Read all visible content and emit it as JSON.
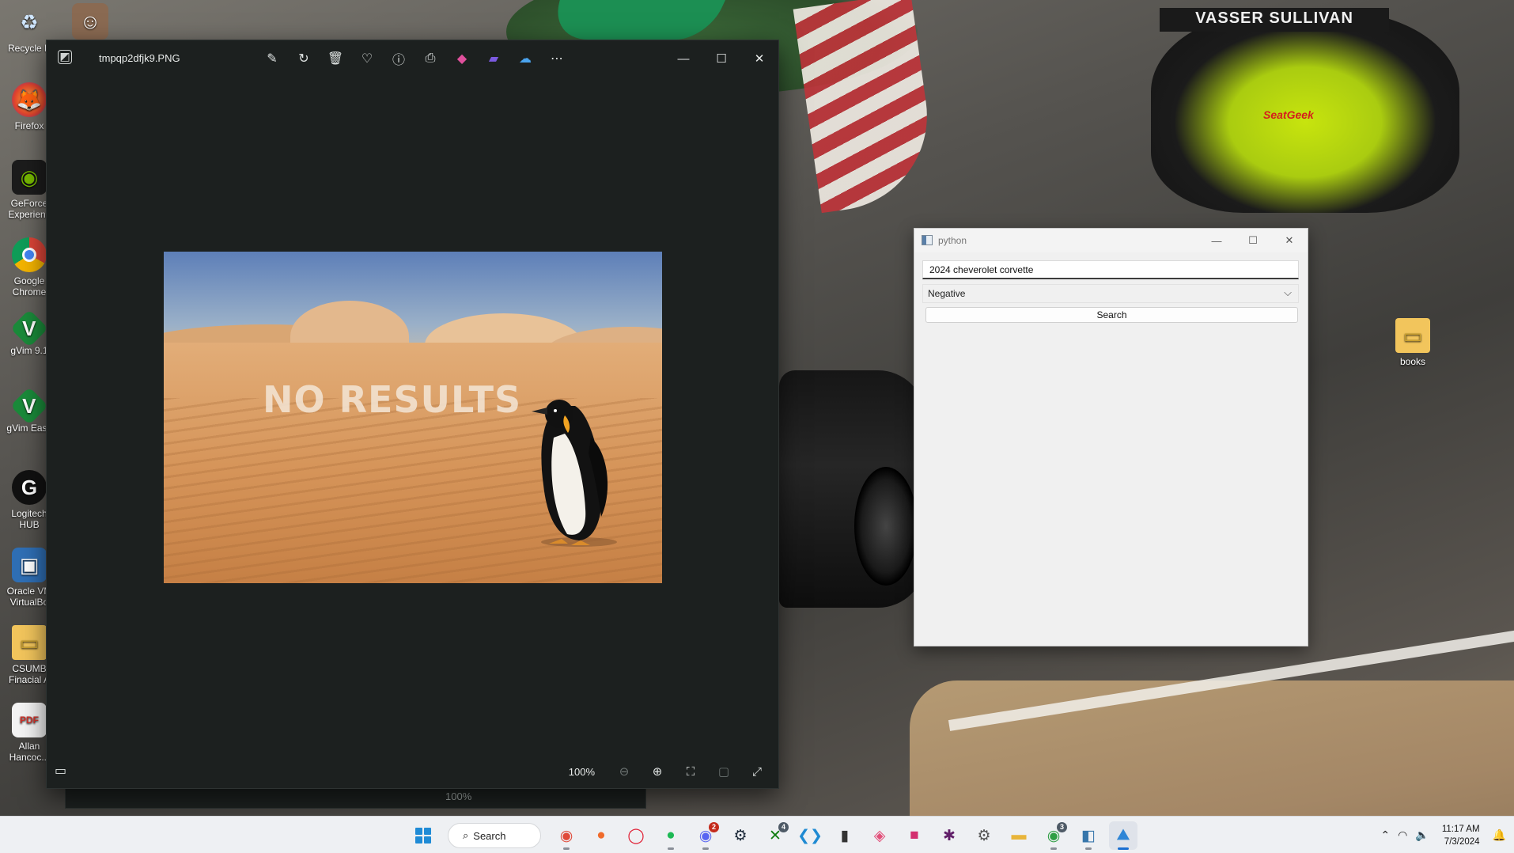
{
  "desktop": {
    "icons": [
      {
        "label": "Recycle B",
        "icon": "recycle-bin-icon"
      },
      {
        "label": "Firefox",
        "icon": "firefox-icon"
      },
      {
        "label": "GeForce Experienc",
        "icon": "geforce-icon"
      },
      {
        "label": "Google Chrome",
        "icon": "chrome-icon"
      },
      {
        "label": "gVim 9.1",
        "icon": "gvim-icon"
      },
      {
        "label": "gVim Easy",
        "icon": "gvim-easy-icon"
      },
      {
        "label": "Logitech HUB",
        "icon": "logitech-icon"
      },
      {
        "label": "Oracle VM VirtualBo",
        "icon": "virtualbox-icon"
      },
      {
        "label": "CSUMB Finacial A",
        "icon": "folder-icon"
      },
      {
        "label": "Allan Hancoc...",
        "icon": "pdf-icon"
      },
      {
        "label": "books",
        "icon": "folder-icon"
      }
    ],
    "wallpaper_texts": {
      "wing": "VASSER SULLIVAN",
      "logo": "SeatGeek"
    }
  },
  "photos_window": {
    "title": "tmpqp2dfjk9.PNG",
    "toolbar": [
      "edit-icon",
      "rotate-icon",
      "delete-icon",
      "favorite-icon",
      "info-icon",
      "print-icon",
      "copilot-icon",
      "clipchamp-icon",
      "onedrive-icon",
      "more-icon"
    ],
    "image_text": "NO RESULTS",
    "zoom": "100%",
    "ghost_zoom": "100%"
  },
  "python_window": {
    "title": "python",
    "search_value": "2024 cheverolet corvette",
    "select_value": "Negative",
    "button_label": "Search"
  },
  "taskbar": {
    "search_label": "Search",
    "apps": [
      {
        "icon": "chrome-icon",
        "badge": ""
      },
      {
        "icon": "firefox-icon",
        "badge": ""
      },
      {
        "icon": "opera-icon",
        "badge": ""
      },
      {
        "icon": "spotify-icon",
        "badge": ""
      },
      {
        "icon": "discord-icon",
        "badge": "2"
      },
      {
        "icon": "steam-icon",
        "badge": ""
      },
      {
        "icon": "xbox-icon",
        "badge": "4"
      },
      {
        "icon": "vscode-icon",
        "badge": ""
      },
      {
        "icon": "terminal-icon",
        "badge": ""
      },
      {
        "icon": "photos-app-icon",
        "badge": ""
      },
      {
        "icon": "intellij-icon",
        "badge": ""
      },
      {
        "icon": "slack-icon",
        "badge": ""
      },
      {
        "icon": "settings-icon",
        "badge": ""
      },
      {
        "icon": "file-explorer-icon",
        "badge": ""
      },
      {
        "icon": "chrome-profile-icon",
        "badge": "3"
      },
      {
        "icon": "python-icon",
        "badge": ""
      },
      {
        "icon": "photos-icon",
        "badge": ""
      }
    ],
    "time": "11:17 AM",
    "date": "7/3/2024"
  }
}
